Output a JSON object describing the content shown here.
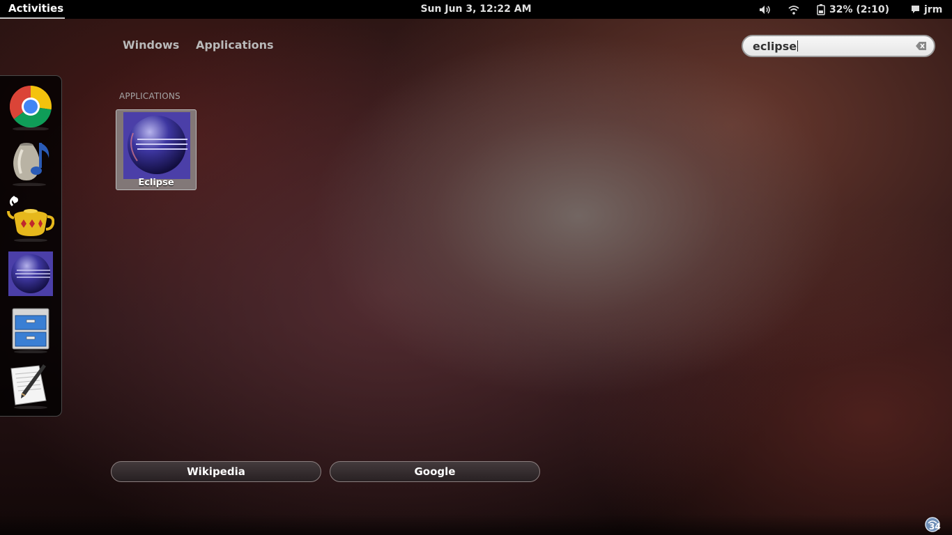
{
  "top_panel": {
    "activities": "Activities",
    "clock": "Sun Jun  3, 12:22 AM",
    "volume_icon": "speaker-icon",
    "network_icon": "wifi-icon",
    "battery_icon": "battery-icon",
    "battery_text": "32% (2:10)",
    "user_icon": "chat-bubble-icon",
    "user_name": "jrm"
  },
  "overview": {
    "tabs": [
      {
        "label": "Windows"
      },
      {
        "label": "Applications"
      }
    ],
    "search": {
      "value": "eclipse",
      "clear_icon": "clear-search-icon"
    }
  },
  "dash": {
    "items": [
      {
        "name": "Google Chrome",
        "icon": "chrome-icon"
      },
      {
        "name": "Banshee / music player",
        "icon": "music-jar-icon"
      },
      {
        "name": "Teapot app",
        "icon": "teapot-icon"
      },
      {
        "name": "Eclipse",
        "icon": "eclipse-icon"
      },
      {
        "name": "File manager",
        "icon": "file-cabinet-icon"
      },
      {
        "name": "Text editor",
        "icon": "text-editor-icon"
      }
    ]
  },
  "results": {
    "heading": "APPLICATIONS",
    "items": [
      {
        "label": "Eclipse",
        "icon": "eclipse-icon"
      }
    ]
  },
  "search_providers": [
    {
      "label": "Wikipedia"
    },
    {
      "label": "Google"
    }
  ],
  "message_tray": {
    "badge_icon": "notification-icon",
    "count": "34"
  },
  "colors": {
    "panel": "#000000",
    "eclipse_purple": "#4b3fa8",
    "search_bg": "#f0f0f0"
  }
}
